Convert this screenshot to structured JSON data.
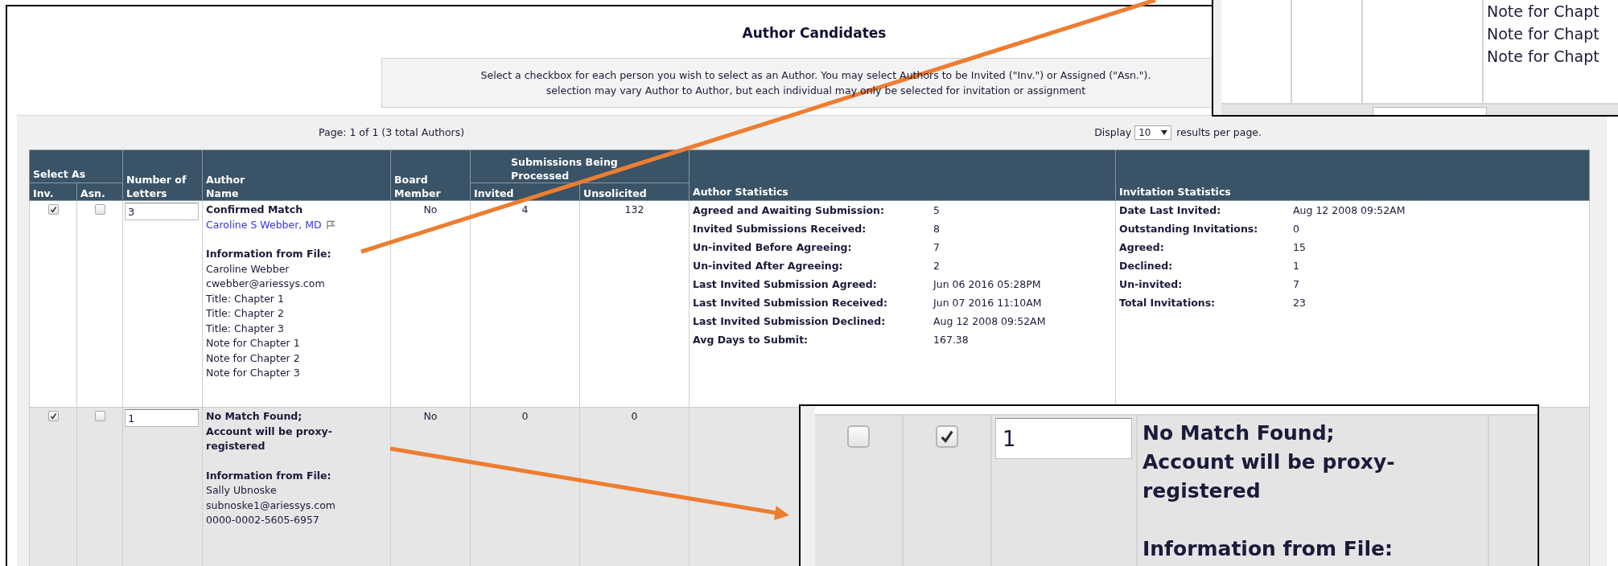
{
  "title": "Author Candidates",
  "instruction_lines": [
    "Select a checkbox for each person you wish to select as an Author. You may select Authors to be Invited (\"Inv.\") or Assigned (\"Asn.\").",
    "selection may vary Author to Author, but each individual may only be selected for invitation or assignment"
  ],
  "pagination": {
    "page_info": "Page: 1 of 1 (3 total Authors)",
    "display_label": "Display",
    "per_page": "10",
    "suffix": "results per page."
  },
  "table": {
    "headers": {
      "select_as": "Select As",
      "inv": "Inv.",
      "asn": "Asn.",
      "letters": "Number of Letters",
      "author_name": "Author Name",
      "board_member": "Board Member",
      "submissions": "Submissions Being Processed",
      "invited": "Invited",
      "unsolicited": "Unsolicited",
      "author_stats": "Author Statistics",
      "invitation_stats": "Invitation Statistics"
    },
    "rows": [
      {
        "shaded": false,
        "inv_checked": true,
        "asn_checked": false,
        "letters": "3",
        "status_lines": [
          "Confirmed Match"
        ],
        "author_link": "Caroline S Webber, MD",
        "info_heading": "Information from File:",
        "info_lines": [
          "Caroline Webber",
          "cwebber@ariessys.com",
          "Title: Chapter 1",
          "Title: Chapter 2",
          "Title: Chapter 3",
          "Note for Chapter 1",
          "Note for Chapter 2",
          "Note for Chapter 3"
        ],
        "board_member": "No",
        "invited": "4",
        "unsolicited": "132",
        "author_stats": [
          {
            "label": "Agreed and Awaiting Submission:",
            "value": "5"
          },
          {
            "label": "Invited Submissions Received:",
            "value": "8"
          },
          {
            "label": "Un-invited Before Agreeing:",
            "value": "7"
          },
          {
            "label": "Un-invited After Agreeing:",
            "value": "2"
          },
          {
            "label": "Last Invited Submission Agreed:",
            "value": "Jun 06 2016 05:28PM"
          },
          {
            "label": "Last Invited Submission Received:",
            "value": "Jun 07 2016 11:10AM"
          },
          {
            "label": "Last Invited Submission Declined:",
            "value": "Aug 12 2008 09:52AM"
          },
          {
            "label": "Avg Days to Submit:",
            "value": "167.38"
          }
        ],
        "invitation_stats": [
          {
            "label": "Date Last Invited:",
            "value": "Aug 12 2008 09:52AM"
          },
          {
            "label": "Outstanding Invitations:",
            "value": "0"
          },
          {
            "label": "Agreed:",
            "value": "15"
          },
          {
            "label": "Declined:",
            "value": "1"
          },
          {
            "label": "Un-invited:",
            "value": "7"
          },
          {
            "label": "Total Invitations:",
            "value": "23"
          }
        ]
      },
      {
        "shaded": true,
        "inv_checked": true,
        "asn_checked": false,
        "letters": "1",
        "status_lines": [
          "No Match Found;",
          "Account will be proxy-registered"
        ],
        "info_heading": "Information from File:",
        "info_lines": [
          "Sally Ubnoske",
          "subnoske1@ariessys.com",
          "0000-0002-5605-6957"
        ],
        "board_member": "No",
        "invited": "0",
        "unsolicited": "0"
      }
    ]
  },
  "callouts": [
    {
      "kind": "notes",
      "lines": [
        "Note for Chapt",
        "Note for Chapt",
        "Note for Chapt"
      ]
    },
    {
      "kind": "row",
      "inv_checked": false,
      "asn_checked": true,
      "letters": "1",
      "status_lines": [
        "No Match Found;",
        "Account will be proxy-registered"
      ],
      "info_heading": "Information from File:"
    }
  ]
}
